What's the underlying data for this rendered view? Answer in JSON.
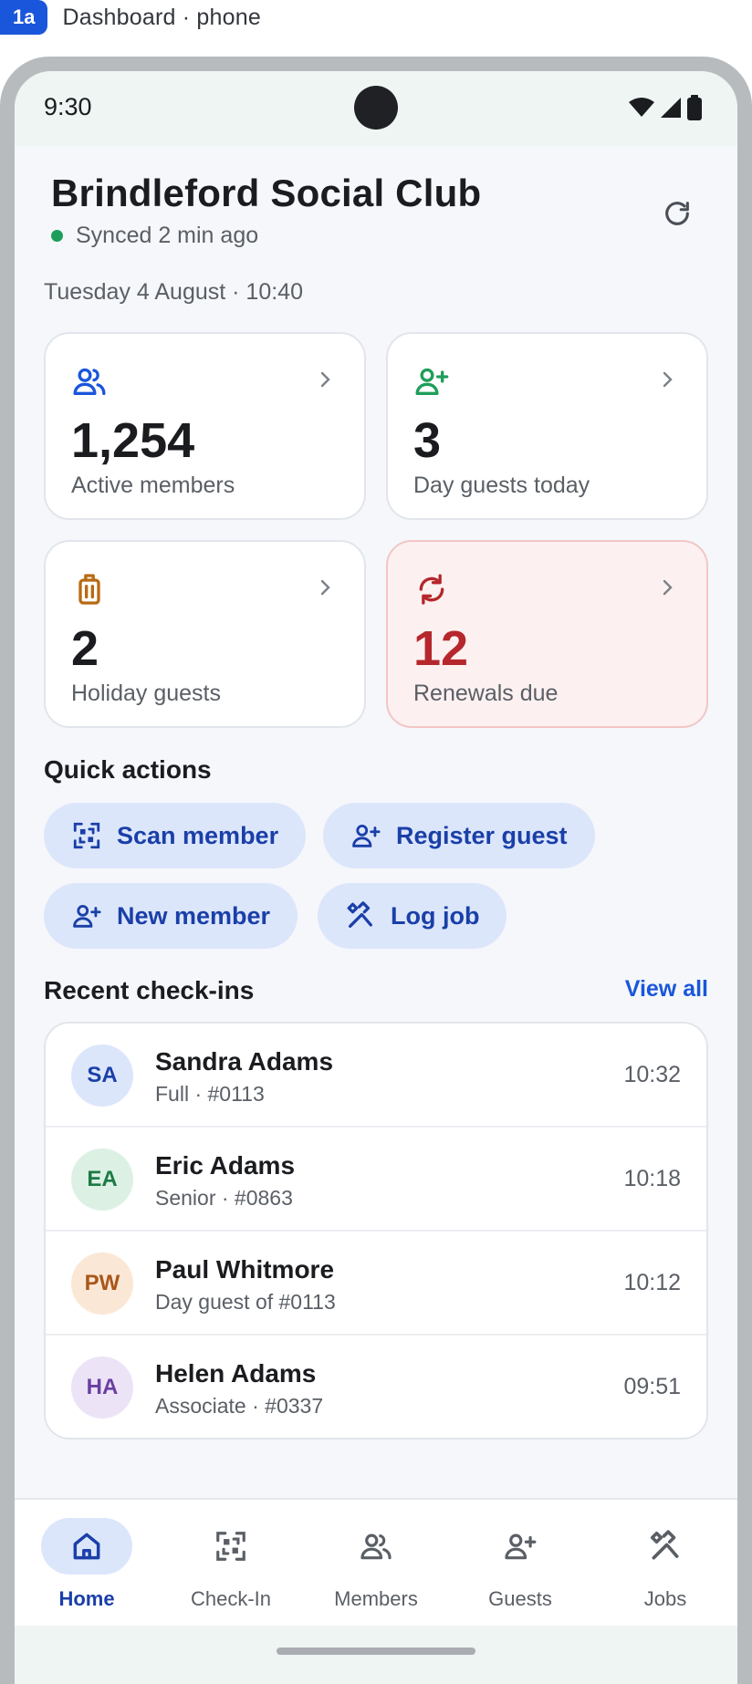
{
  "screen": {
    "tag": "1a",
    "title": "Dashboard · phone"
  },
  "status": {
    "time": "9:30",
    "icons": [
      "wifi-icon",
      "signal-icon",
      "battery-icon"
    ]
  },
  "header": {
    "title": "Brindleford Social Club",
    "sync_text": "Synced 2 min ago",
    "date_line": "Tuesday 4 August · 10:40",
    "refresh_icon": "refresh-icon"
  },
  "stats": [
    {
      "value": "1,254",
      "label": "Active members",
      "icon": "members-icon",
      "color": "#1a56db"
    },
    {
      "value": "3",
      "label": "Day guests today",
      "icon": "add-person-icon",
      "color": "#1e9e5a"
    },
    {
      "value": "2",
      "label": "Holiday guests",
      "icon": "luggage-icon",
      "color": "#b86a12"
    },
    {
      "value": "12",
      "label": "Renewals due",
      "icon": "renew-icon",
      "color": "#b5272c"
    }
  ],
  "quick_actions": {
    "title": "Quick actions",
    "items": [
      {
        "label": "Scan member",
        "icon": "qr-scan-icon"
      },
      {
        "label": "Register guest",
        "icon": "add-person-icon"
      },
      {
        "label": "New member",
        "icon": "add-person-icon"
      },
      {
        "label": "Log job",
        "icon": "tools-icon"
      }
    ]
  },
  "recent": {
    "title": "Recent check-ins",
    "view_all": "View all",
    "rows": [
      {
        "initials": "SA",
        "name": "Sandra Adams",
        "sub": "Full · #0113",
        "time": "10:32",
        "bg": "#dce6fb",
        "fg": "#1a3fa8"
      },
      {
        "initials": "EA",
        "name": "Eric Adams",
        "sub": "Senior · #0863",
        "time": "10:18",
        "bg": "#dcf1e4",
        "fg": "#1b7a45"
      },
      {
        "initials": "PW",
        "name": "Paul Whitmore",
        "sub": "Day guest of #0113",
        "time": "10:12",
        "bg": "#fbe7d6",
        "fg": "#a8581a"
      },
      {
        "initials": "HA",
        "name": "Helen Adams",
        "sub": "Associate · #0337",
        "time": "09:51",
        "bg": "#ece3f7",
        "fg": "#6a3fa0"
      }
    ]
  },
  "nav": {
    "items": [
      {
        "label": "Home",
        "icon": "home-icon",
        "active": true
      },
      {
        "label": "Check-In",
        "icon": "qr-scan-icon",
        "active": false
      },
      {
        "label": "Members",
        "icon": "members-icon",
        "active": false
      },
      {
        "label": "Guests",
        "icon": "add-person-icon",
        "active": false
      },
      {
        "label": "Jobs",
        "icon": "tools-icon",
        "active": false
      }
    ]
  }
}
